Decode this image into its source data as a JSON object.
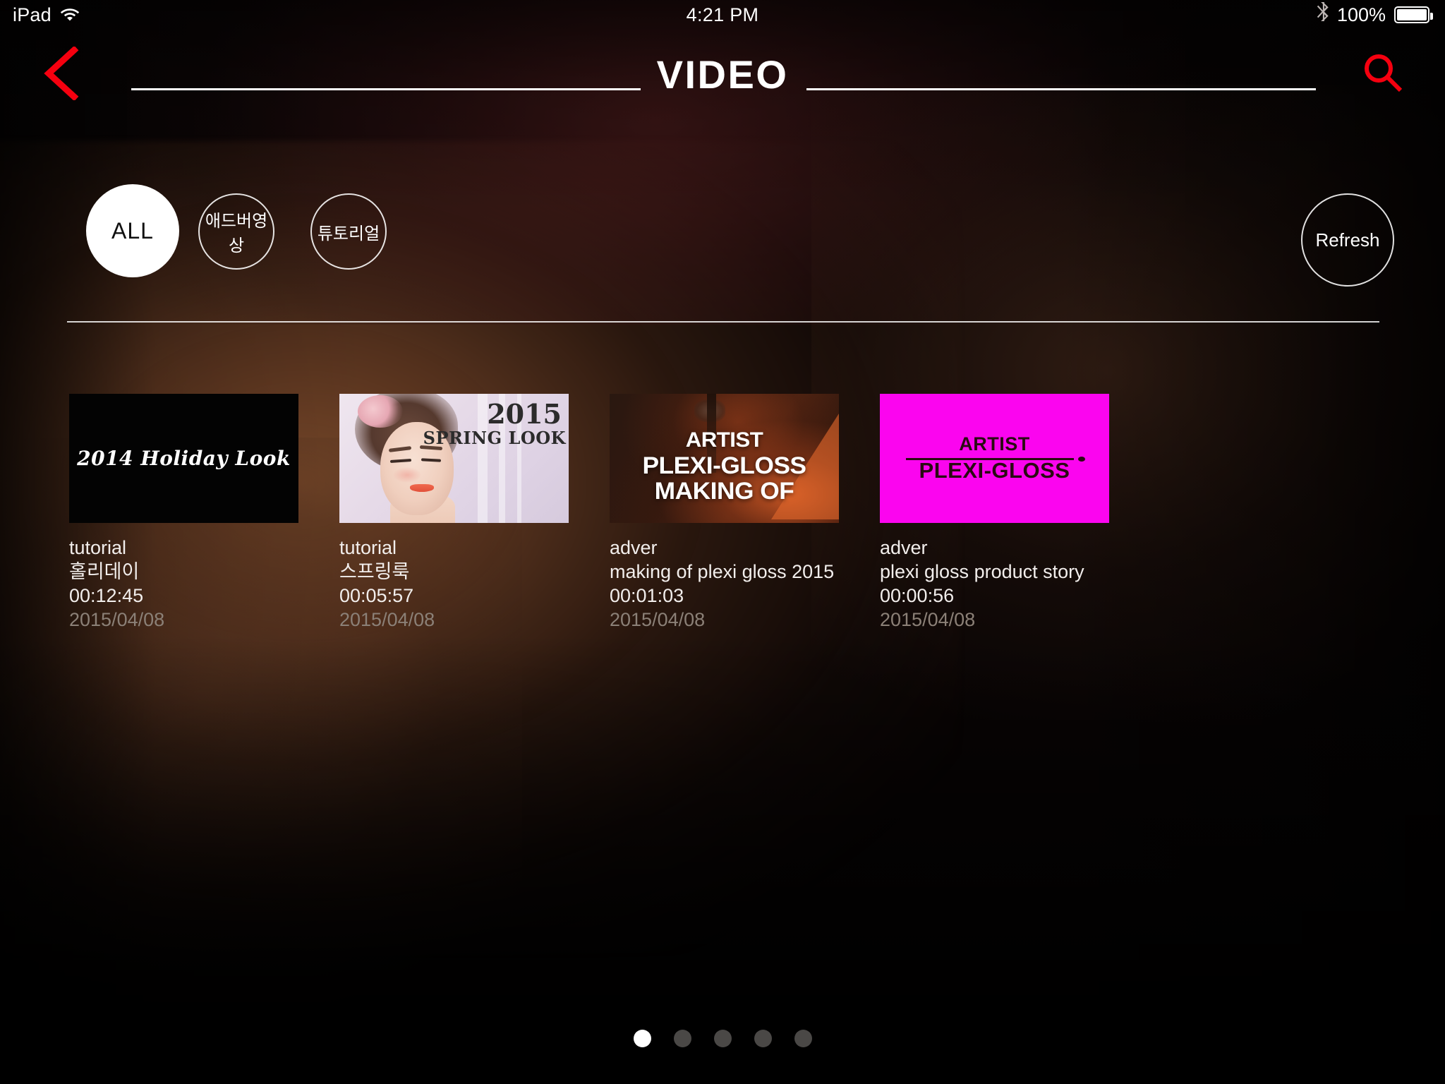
{
  "statusbar": {
    "device": "iPad",
    "wifi_icon": "wifi-icon",
    "time": "4:21 PM",
    "bluetooth_icon": "bluetooth-icon",
    "battery_percent": "100%",
    "battery_icon": "battery-full-icon"
  },
  "header": {
    "back_icon": "back-chevron-icon",
    "title": "VIDEO",
    "search_icon": "search-icon",
    "accent_color": "#f5000f",
    "rule_color": "#ffffff"
  },
  "filters": {
    "items": [
      {
        "label": "ALL",
        "active": true
      },
      {
        "label": "애드버영상",
        "active": false
      },
      {
        "label": "튜토리얼",
        "active": false
      }
    ],
    "refresh_label": "Refresh"
  },
  "videos": [
    {
      "category": "tutorial",
      "title": "홀리데이",
      "duration": "00:12:45",
      "date": "2015/04/08",
      "thumb": {
        "kind": "holiday",
        "text": "2014 Holiday Look",
        "background": "#030303"
      }
    },
    {
      "category": "tutorial",
      "title": "스프링룩",
      "duration": "00:05:57",
      "date": "2015/04/08",
      "thumb": {
        "kind": "spring",
        "year": "2015",
        "caption": "SPRING LOOK",
        "background": "#e8dde9"
      }
    },
    {
      "category": "adver",
      "title": "making of plexi gloss 2015",
      "duration": "00:01:03",
      "date": "2015/04/08",
      "thumb": {
        "kind": "makingof",
        "line1": "ARTIST",
        "line2": "PLEXI-GLOSS",
        "line3": "MAKING OF",
        "background": "#3a1c10"
      }
    },
    {
      "category": "adver",
      "title": "plexi gloss product story",
      "duration": "00:00:56",
      "date": "2015/04/08",
      "thumb": {
        "kind": "magenta",
        "line1": "ARTIST",
        "line2": "PLEXI-GLOSS",
        "background": "#fb05ef",
        "text_color": "#2a0a12"
      }
    }
  ],
  "pager": {
    "total": 5,
    "current": 1
  }
}
